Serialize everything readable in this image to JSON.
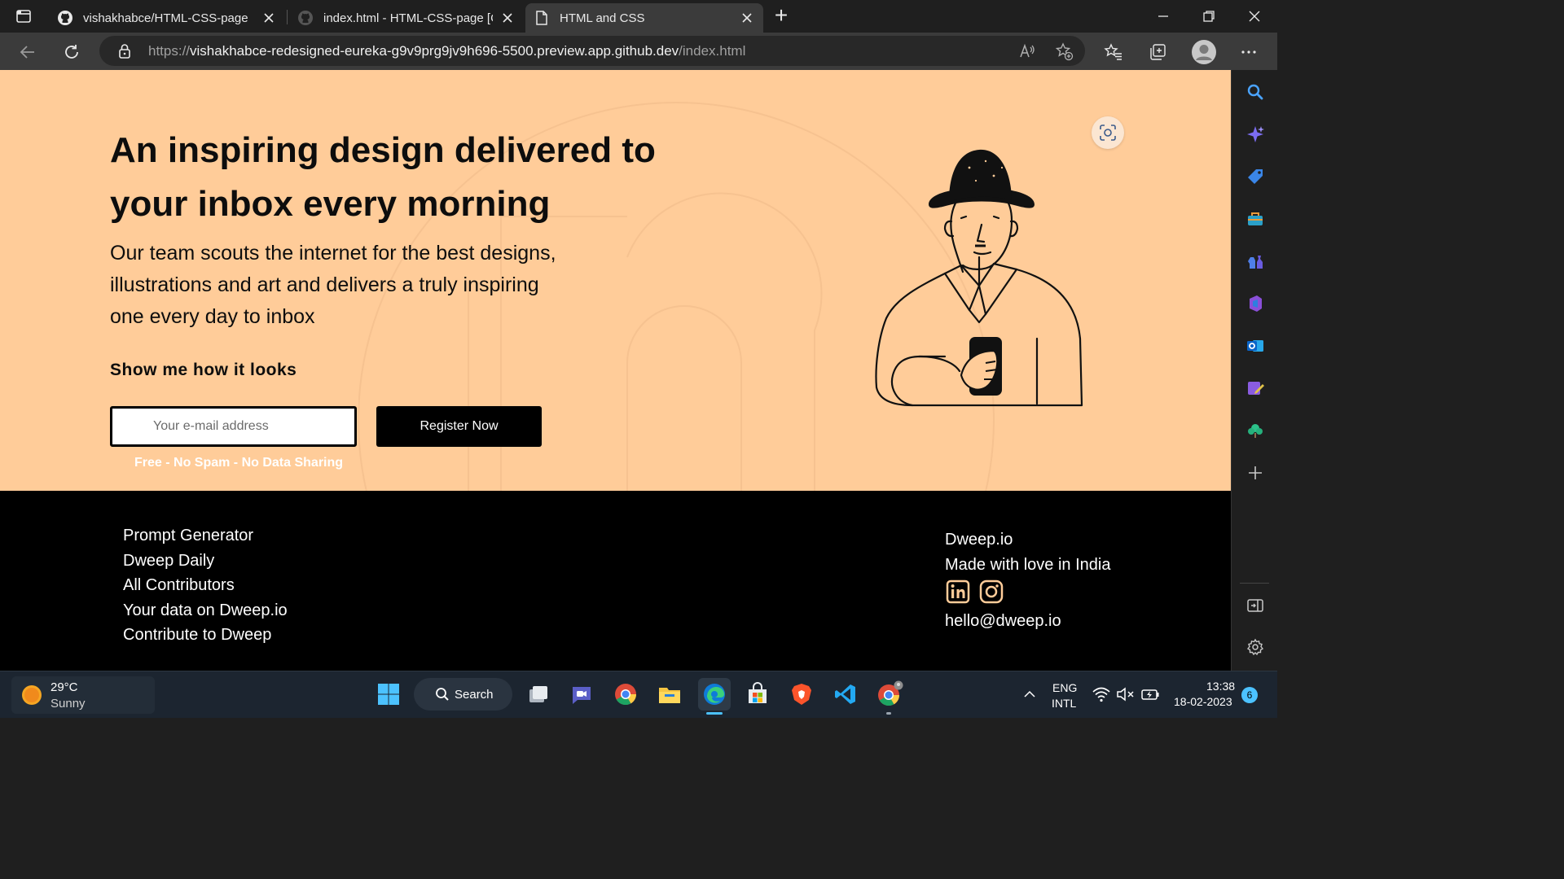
{
  "browser": {
    "tabs": [
      {
        "title": "vishakhabce/HTML-CSS-page",
        "icon": "github-icon"
      },
      {
        "title": "index.html - HTML-CSS-page [Co",
        "icon": "github-icon"
      },
      {
        "title": "HTML and CSS",
        "icon": "page-icon",
        "active": true
      }
    ],
    "new_tab_label": "+",
    "url": {
      "scheme": "https://",
      "host": "vishakhabce-redesigned-eureka-g9v9prg9jv9h696-5500.preview.app.github.dev",
      "path": "/index.html"
    }
  },
  "hero": {
    "headline": "An inspiring design delivered to your inbox every morning",
    "subtext": "Our team scouts the internet for the best designs, illustrations and art and delivers a truly inspiring one every day to inbox",
    "cta_heading": "Show me how it looks",
    "email_placeholder": "Your e-mail address",
    "register_label": "Register Now",
    "note": "Free - No Spam - No Data Sharing",
    "background_color": "#ffcc99"
  },
  "footer": {
    "links": [
      "Prompt Generator",
      "Dweep Daily",
      "All Contributors",
      "Your data on Dweep.io",
      "Contribute to Dweep"
    ],
    "brand": "Dweep.io",
    "tagline": "Made with love in India",
    "email": "hello@dweep.io",
    "social_icons": [
      "linkedin-icon",
      "instagram-icon"
    ]
  },
  "sidebar": {
    "icons": [
      "search-icon",
      "copilot-icon",
      "shopping-tag-icon",
      "tools-icon",
      "games-icon",
      "office-icon",
      "outlook-icon",
      "designer-icon",
      "tree-icon",
      "add-icon",
      "split-screen-icon",
      "settings-icon"
    ]
  },
  "taskbar": {
    "weather_temp": "29°C",
    "weather_desc": "Sunny",
    "search_label": "Search",
    "lang_top": "ENG",
    "lang_bottom": "INTL",
    "time": "13:38",
    "date": "18-02-2023",
    "notification_count": "6"
  }
}
